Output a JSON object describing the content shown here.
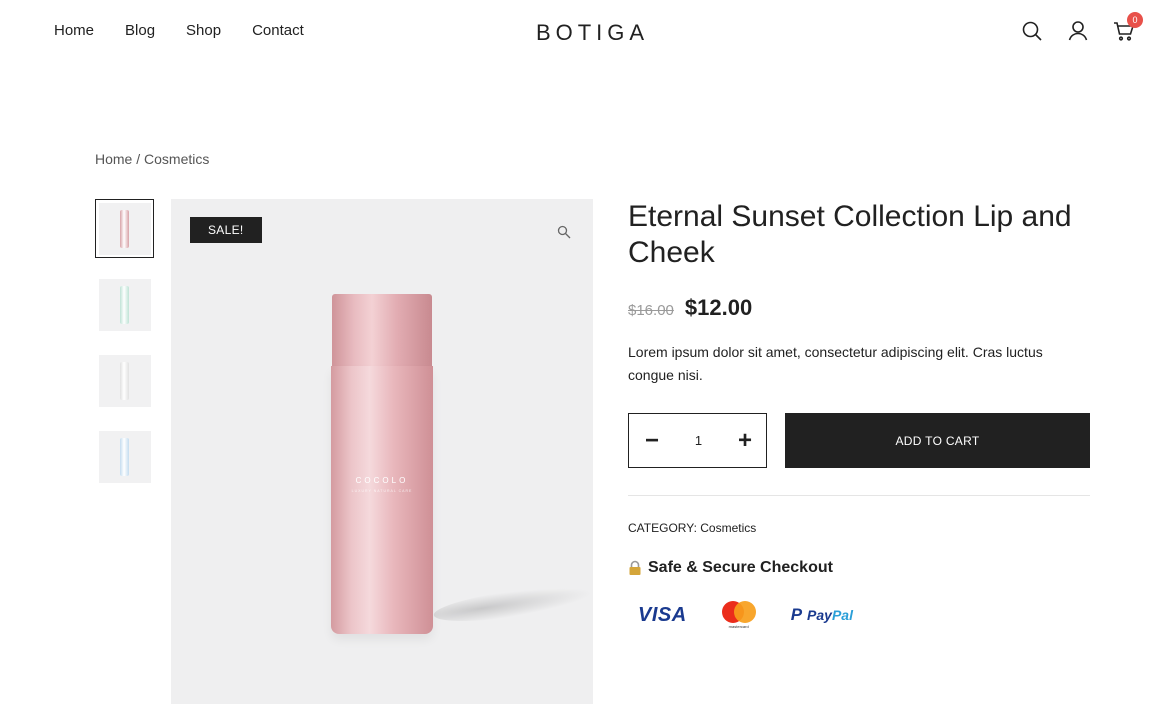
{
  "header": {
    "nav": [
      "Home",
      "Blog",
      "Shop",
      "Contact"
    ],
    "logo": "BOTIGA",
    "icons": [
      "search-icon",
      "account-icon",
      "cart-icon"
    ],
    "cart_count": "0"
  },
  "breadcrumb": {
    "home": "Home",
    "separator": " / ",
    "current": "Cosmetics"
  },
  "gallery": {
    "sale_label": "SALE!",
    "thumbnails": [
      {
        "color": "#d8a3a8",
        "active": true
      },
      {
        "color": "#bfe3d6",
        "active": false
      },
      {
        "color": "#e1e1e1",
        "active": false
      },
      {
        "color": "#c4dcef",
        "active": false
      }
    ],
    "product_brand": "COCOLO",
    "product_sub": "LUXURY NATURAL CARE"
  },
  "product": {
    "title": "Eternal Sunset Collection Lip and Cheek",
    "price_old": "$16.00",
    "price_new": "$12.00",
    "description": "Lorem ipsum dolor sit amet, consectetur adipiscing elit. Cras luctus congue nisi.",
    "quantity": "1",
    "qty_minus": "−",
    "qty_plus": "+",
    "add_to_cart": "ADD TO CART",
    "category_label": "CATEGORY: ",
    "category_value": "Cosmetics",
    "secure_checkout": "Safe & Secure Checkout",
    "payments": {
      "visa": "VISA",
      "mastercard": "mastercard",
      "paypal_pay": "Pay",
      "paypal_pal": "Pal"
    }
  },
  "colors": {
    "text": "#212121",
    "button": "#212121",
    "badge": "#e8514a",
    "image_bg": "#efeff0"
  }
}
